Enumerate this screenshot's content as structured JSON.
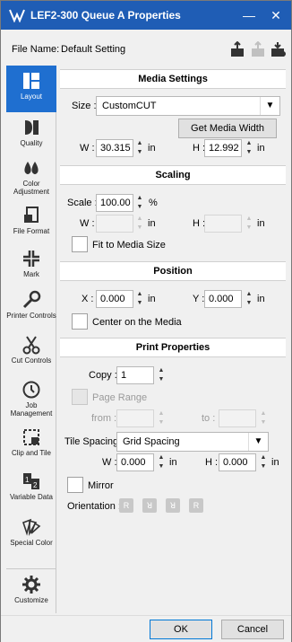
{
  "window": {
    "title": "LEF2-300 Queue A Properties",
    "minimize": "—",
    "close": "✕"
  },
  "file": {
    "label": "File Name:",
    "value": "Default Setting"
  },
  "sidebar": {
    "items": [
      {
        "label": "Layout",
        "icon": "layout-icon"
      },
      {
        "label": "Quality",
        "icon": "quality-icon"
      },
      {
        "label": "Color Adjustment",
        "icon": "color-adjustment-icon"
      },
      {
        "label": "File Format",
        "icon": "file-format-icon"
      },
      {
        "label": "Mark",
        "icon": "mark-icon"
      },
      {
        "label": "Printer Controls",
        "icon": "printer-controls-icon"
      },
      {
        "label": "Cut Controls",
        "icon": "cut-controls-icon"
      },
      {
        "label": "Job Management",
        "icon": "job-management-icon"
      },
      {
        "label": "Clip and Tile",
        "icon": "clip-and-tile-icon"
      },
      {
        "label": "Variable Data",
        "icon": "variable-data-icon"
      },
      {
        "label": "Special Color",
        "icon": "special-color-icon"
      },
      {
        "label": "Customize",
        "icon": "customize-icon"
      }
    ]
  },
  "media": {
    "title": "Media Settings",
    "size_label": "Size :",
    "size_value": "CustomCUT",
    "get_width": "Get Media Width",
    "w_label": "W :",
    "w_value": "30.315",
    "w_unit": "in",
    "h_label": "H :",
    "h_value": "12.992",
    "h_unit": "in"
  },
  "scaling": {
    "title": "Scaling",
    "scale_label": "Scale :",
    "scale_value": "100.00",
    "scale_unit": "%",
    "w_label": "W :",
    "w_unit": "in",
    "h_label": "H :",
    "h_unit": "in",
    "fit_label": "Fit to Media Size"
  },
  "position": {
    "title": "Position",
    "x_label": "X :",
    "x_value": "0.000",
    "x_unit": "in",
    "y_label": "Y :",
    "y_value": "0.000",
    "y_unit": "in",
    "center_label": "Center on the Media"
  },
  "print": {
    "title": "Print Properties",
    "copy_label": "Copy :",
    "copy_value": "1",
    "page_range_label": "Page Range",
    "from_label": "from :",
    "to_label": "to :",
    "tile_label": "Tile Spacing :",
    "tile_value": "Grid Spacing",
    "w_label": "W :",
    "w_value": "0.000",
    "w_unit": "in",
    "h_label": "H :",
    "h_value": "0.000",
    "h_unit": "in",
    "mirror_label": "Mirror",
    "orientation_label": "Orientation :"
  },
  "footer": {
    "ok": "OK",
    "cancel": "Cancel"
  },
  "colors": {
    "titlebar": "#1f5db5",
    "active_tab": "#1f6fd0"
  }
}
